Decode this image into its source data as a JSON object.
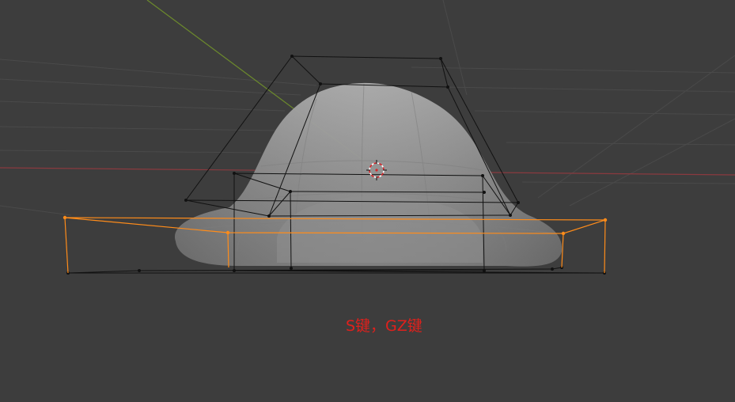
{
  "viewport": {
    "caption": "S键，GZ键",
    "colors": {
      "background": "#3d3d3d",
      "grid_line": "#4a4a4a",
      "x_axis": "#8a3a3f",
      "y_axis": "#6c8a2c",
      "mesh_fill": "#9b9b9b",
      "cage_edge": "#111111",
      "selected_edge": "#ff8c1a",
      "caption": "#e0201c"
    },
    "icons": {
      "cursor": "3d-cursor-icon"
    }
  }
}
